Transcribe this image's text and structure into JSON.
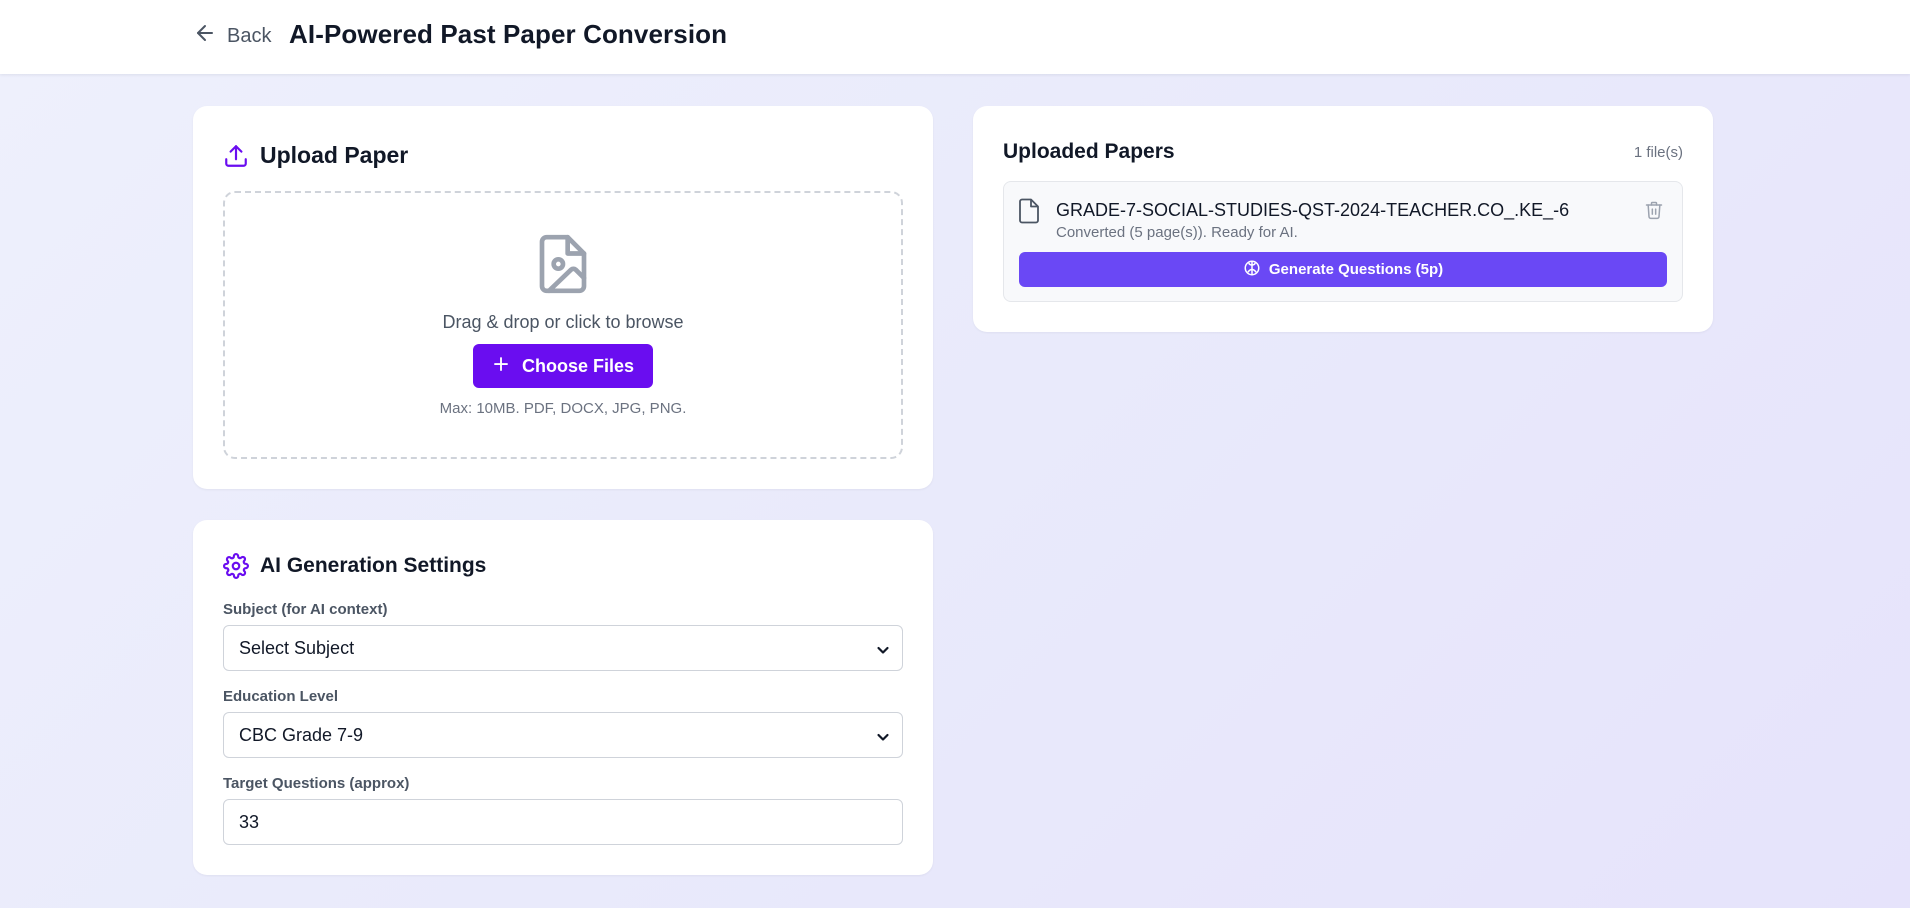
{
  "header": {
    "back_label": "Back",
    "title": "AI-Powered Past Paper Conversion"
  },
  "upload": {
    "title": "Upload Paper",
    "icon": "upload-icon",
    "dropzone_text": "Drag & drop or click to browse",
    "choose_label": "Choose Files",
    "hint": "Max: 10MB. PDF, DOCX, JPG, PNG."
  },
  "settings": {
    "title": "AI Generation Settings",
    "icon": "gear-icon",
    "subject_label": "Subject (for AI context)",
    "subject_value": "Select Subject",
    "level_label": "Education Level",
    "level_value": "CBC Grade 7-9",
    "target_label": "Target Questions (approx)",
    "target_value": "33"
  },
  "papers": {
    "title": "Uploaded Papers",
    "count": "1 file(s)",
    "files": [
      {
        "name": "GRADE-7-SOCIAL-STUDIES-QST-2024-TEACHER.CO_.KE_-6",
        "status": "Converted (5 page(s)). Ready for AI.",
        "action_label": "Generate Questions (5p)"
      }
    ]
  },
  "colors": {
    "accent": "#6a0df0",
    "generate_button": "#6a48f5",
    "background": "#eceefc"
  }
}
